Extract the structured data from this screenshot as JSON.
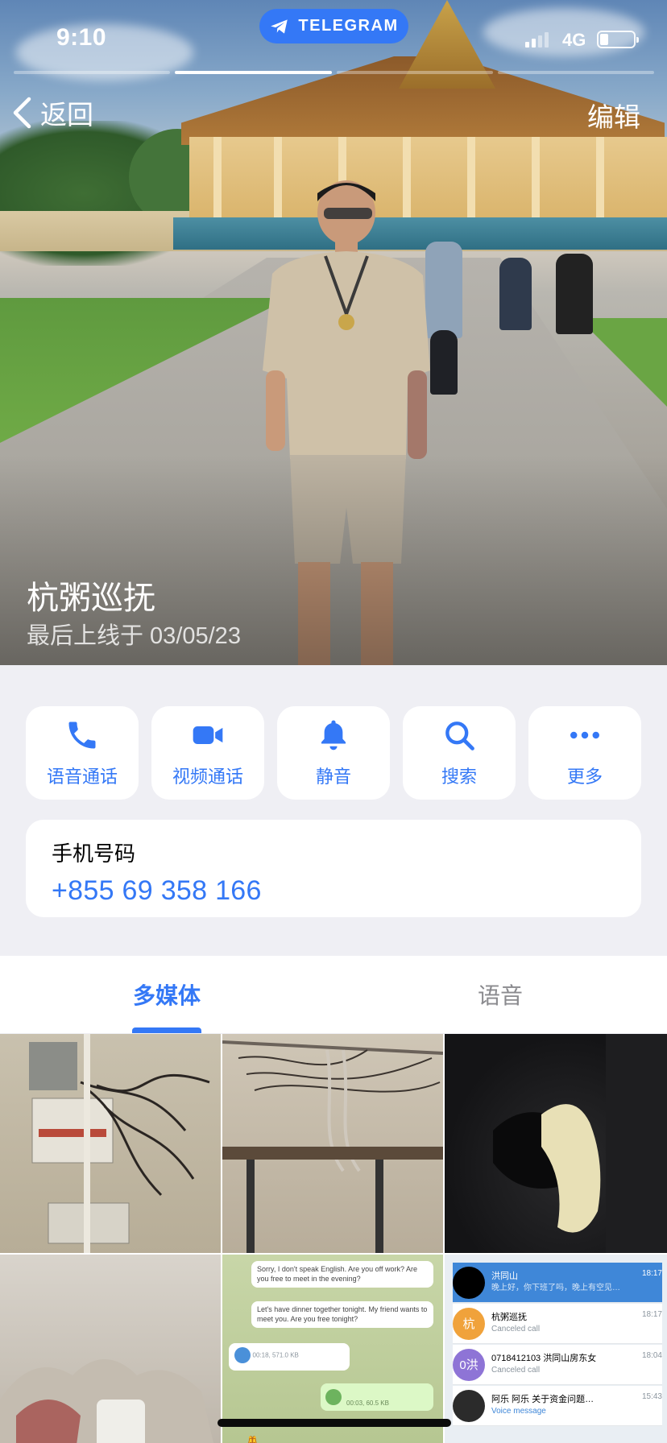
{
  "status_bar": {
    "time": "9:10",
    "network": "4G",
    "pill_label": "TELEGRAM",
    "battery_level": 0.25
  },
  "story_progress": {
    "segments": 4,
    "active_index": 1
  },
  "nav": {
    "back_label": "返回",
    "edit_label": "编辑"
  },
  "profile": {
    "name": "杭粥巡抚",
    "last_seen": "最后上线于 03/05/23"
  },
  "actions": [
    {
      "label": "语音通话",
      "icon": "phone-icon"
    },
    {
      "label": "视频通话",
      "icon": "video-camera-icon"
    },
    {
      "label": "静音",
      "icon": "bell-icon"
    },
    {
      "label": "搜索",
      "icon": "search-icon"
    },
    {
      "label": "更多",
      "icon": "more-dots-icon"
    }
  ],
  "phone": {
    "label": "手机号码",
    "number": "+855 69 358 166"
  },
  "tabs": [
    {
      "label": "多媒体",
      "active": true
    },
    {
      "label": "语音",
      "active": false
    }
  ],
  "media_thumbs": {
    "cell5": {
      "msg1": "Sorry, I don't speak English. Are you off work? Are you free to meet in the evening?",
      "msg2": "Let's have dinner together tonight. My friend wants to meet you. Are you free tonight?",
      "voice1_meta": "00:18, 571.0 KB",
      "voice2_meta": "00:03, 60.5 KB",
      "emoji": "🙏"
    },
    "cell6": {
      "rows": [
        {
          "title": "洪同山",
          "sub": "晚上好，你下班了吗，晚上有空见…",
          "time": "18:17"
        },
        {
          "title": "杭粥巡抚",
          "sub": "Canceled call",
          "time": "18:17",
          "avatar": "杭"
        },
        {
          "title": "0718412103 洪同山房东女",
          "sub": "Canceled call",
          "time": "18:04",
          "avatar": "0洪"
        },
        {
          "title": "阿乐 阿乐 关于资金问题…",
          "sub": "Voice message",
          "time": "15:43"
        }
      ]
    }
  },
  "colors": {
    "accent": "#3478f6",
    "background": "#efeff4",
    "card": "#ffffff"
  }
}
